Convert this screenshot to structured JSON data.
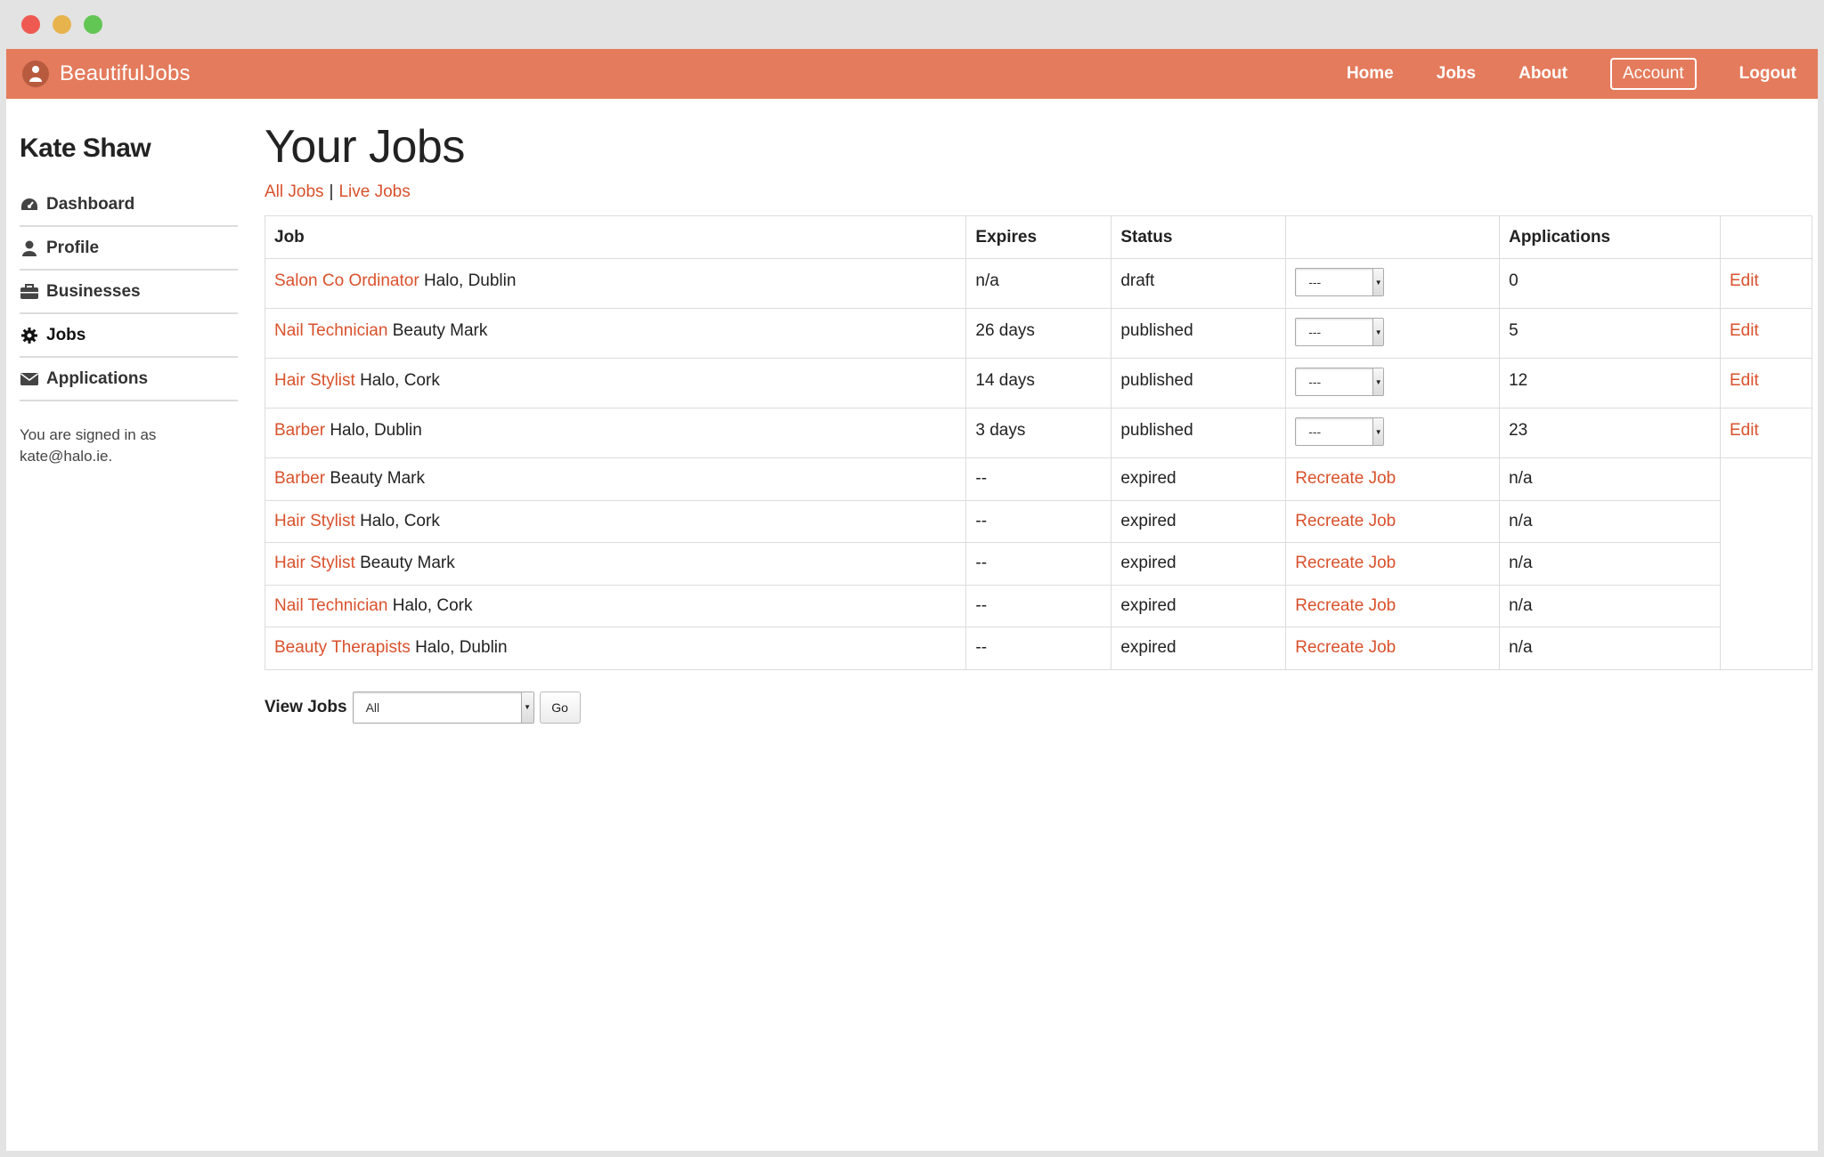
{
  "brand": {
    "name": "BeautifulJobs"
  },
  "nav": {
    "home": "Home",
    "jobs": "Jobs",
    "about": "About",
    "account": "Account",
    "logout": "Logout"
  },
  "sidebar": {
    "user_name": "Kate Shaw",
    "items": [
      {
        "label": "Dashboard",
        "icon": "dashboard-icon"
      },
      {
        "label": "Profile",
        "icon": "user-icon"
      },
      {
        "label": "Businesses",
        "icon": "briefcase-icon"
      },
      {
        "label": "Jobs",
        "icon": "gear-icon"
      },
      {
        "label": "Applications",
        "icon": "envelope-icon"
      }
    ],
    "signed_in_line1": "You are signed in as",
    "signed_in_line2": "kate@halo.ie."
  },
  "main": {
    "title": "Your Jobs",
    "filter_all": "All Jobs",
    "filter_sep": "|",
    "filter_live": "Live Jobs",
    "columns": {
      "job": "Job",
      "expires": "Expires",
      "status": "Status",
      "action": "",
      "applications": "Applications",
      "edit": ""
    },
    "rows": [
      {
        "title": "Salon Co Ordinator",
        "business": "Halo, Dublin",
        "expires": "n/a",
        "status": "draft",
        "select": "---",
        "applications": "0",
        "edit": "Edit"
      },
      {
        "title": "Nail Technician",
        "business": "Beauty Mark",
        "expires": "26 days",
        "status": "published",
        "select": "---",
        "applications": "5",
        "edit": "Edit"
      },
      {
        "title": "Hair Stylist",
        "business": "Halo, Cork",
        "expires": "14 days",
        "status": "published",
        "select": "---",
        "applications": "12",
        "edit": "Edit"
      },
      {
        "title": "Barber",
        "business": "Halo, Dublin",
        "expires": "3 days",
        "status": "published",
        "select": "---",
        "applications": "23",
        "edit": "Edit"
      },
      {
        "title": "Barber",
        "business": "Beauty Mark",
        "expires": "--",
        "status": "expired",
        "recreate": "Recreate Job",
        "applications": "n/a"
      },
      {
        "title": "Hair Stylist",
        "business": "Halo, Cork",
        "expires": "--",
        "status": "expired",
        "recreate": "Recreate Job",
        "applications": "n/a"
      },
      {
        "title": "Hair Stylist",
        "business": "Beauty Mark",
        "expires": "--",
        "status": "expired",
        "recreate": "Recreate Job",
        "applications": "n/a"
      },
      {
        "title": "Nail Technician",
        "business": "Halo, Cork",
        "expires": "--",
        "status": "expired",
        "recreate": "Recreate Job",
        "applications": "n/a"
      },
      {
        "title": "Beauty Therapists",
        "business": "Halo, Dublin",
        "expires": "--",
        "status": "expired",
        "recreate": "Recreate Job",
        "applications": "n/a"
      }
    ],
    "view_jobs_label": "View Jobs",
    "view_jobs_selected": "All",
    "go_label": "Go"
  },
  "colors": {
    "navbar": "#e47b5c",
    "link": "#d9512c"
  }
}
